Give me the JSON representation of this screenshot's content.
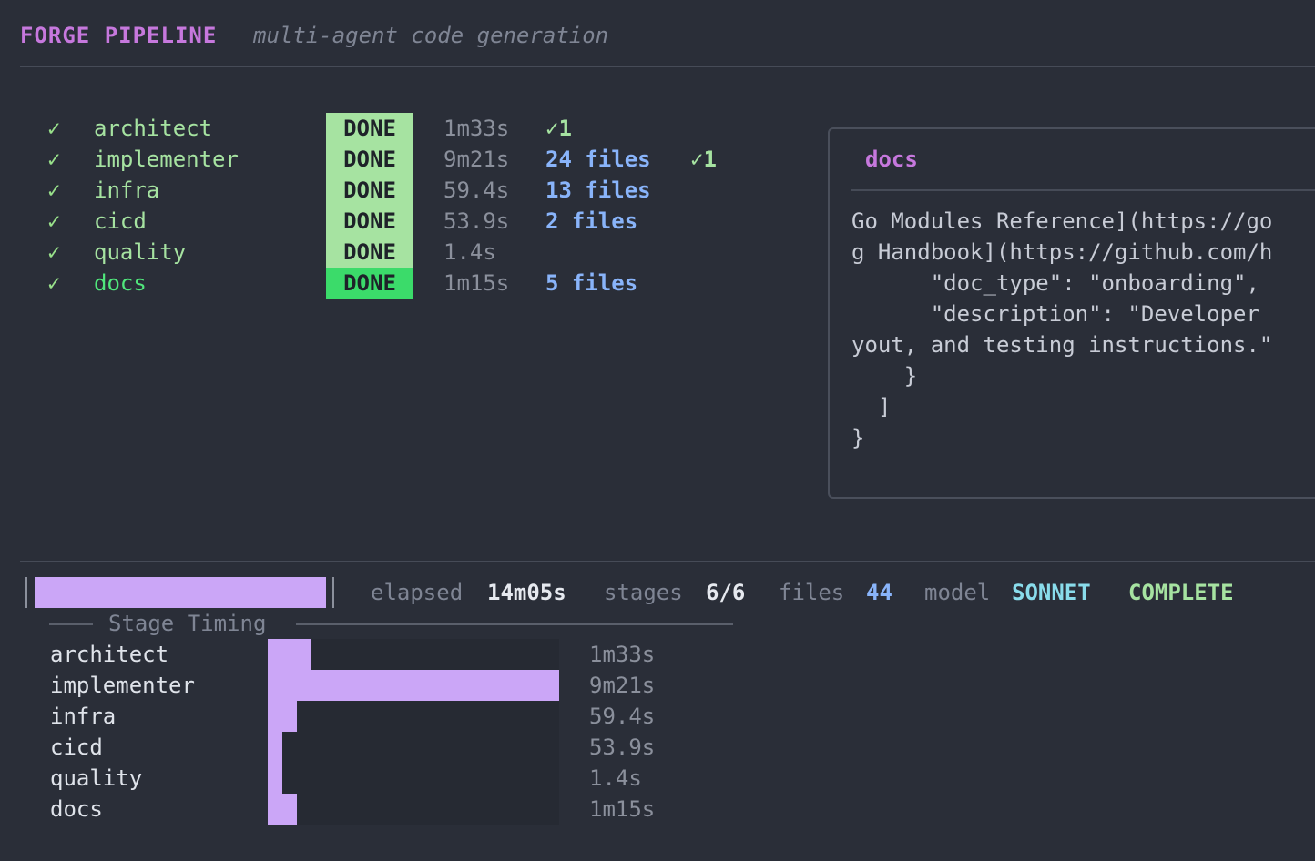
{
  "header": {
    "title": "FORGE PIPELINE",
    "subtitle": "multi-agent code generation"
  },
  "stages": [
    {
      "check": "✓",
      "name": "architect",
      "status": "DONE",
      "time": "1m33s",
      "files": "",
      "retry": "✓1",
      "active": false
    },
    {
      "check": "✓",
      "name": "implementer",
      "status": "DONE",
      "time": "9m21s",
      "files": "24 files",
      "retry": "✓1",
      "active": false
    },
    {
      "check": "✓",
      "name": "infra",
      "status": "DONE",
      "time": "59.4s",
      "files": "13 files",
      "retry": "",
      "active": false
    },
    {
      "check": "✓",
      "name": "cicd",
      "status": "DONE",
      "time": "53.9s",
      "files": "2 files",
      "retry": "",
      "active": false
    },
    {
      "check": "✓",
      "name": "quality",
      "status": "DONE",
      "time": "1.4s",
      "files": "",
      "retry": "",
      "active": false
    },
    {
      "check": "✓",
      "name": "docs",
      "status": "DONE",
      "time": "1m15s",
      "files": "5 files",
      "retry": "",
      "active": true
    }
  ],
  "panel": {
    "title": "docs",
    "lines": [
      "Go Modules Reference](https://go",
      "g Handbook](https://github.com/h",
      "      \"doc_type\": \"onboarding\",",
      "      \"description\": \"Developer",
      "yout, and testing instructions.\"",
      "    }",
      "  ]",
      "}"
    ]
  },
  "status": {
    "progress": 1.0,
    "elapsed_label": "elapsed",
    "elapsed_value": "14m05s",
    "stages_label": "stages",
    "stages_value": "6/6",
    "files_label": "files",
    "files_value": "44",
    "model_label": "model",
    "model_value": "SONNET",
    "state": "COMPLETE"
  },
  "timing": {
    "title": "Stage Timing",
    "rows": [
      {
        "name": "architect",
        "time": "1m33s",
        "fraction": 0.15
      },
      {
        "name": "implementer",
        "time": "9m21s",
        "fraction": 1.0
      },
      {
        "name": "infra",
        "time": "59.4s",
        "fraction": 0.1
      },
      {
        "name": "cicd",
        "time": "53.9s",
        "fraction": 0.05
      },
      {
        "name": "quality",
        "time": "1.4s",
        "fraction": 0.05
      },
      {
        "name": "docs",
        "time": "1m15s",
        "fraction": 0.1
      }
    ]
  },
  "colors": {
    "accent": "#c678dd",
    "done": "#a6e3a1",
    "bar": "#cba6f7",
    "files": "#89b4fa"
  }
}
